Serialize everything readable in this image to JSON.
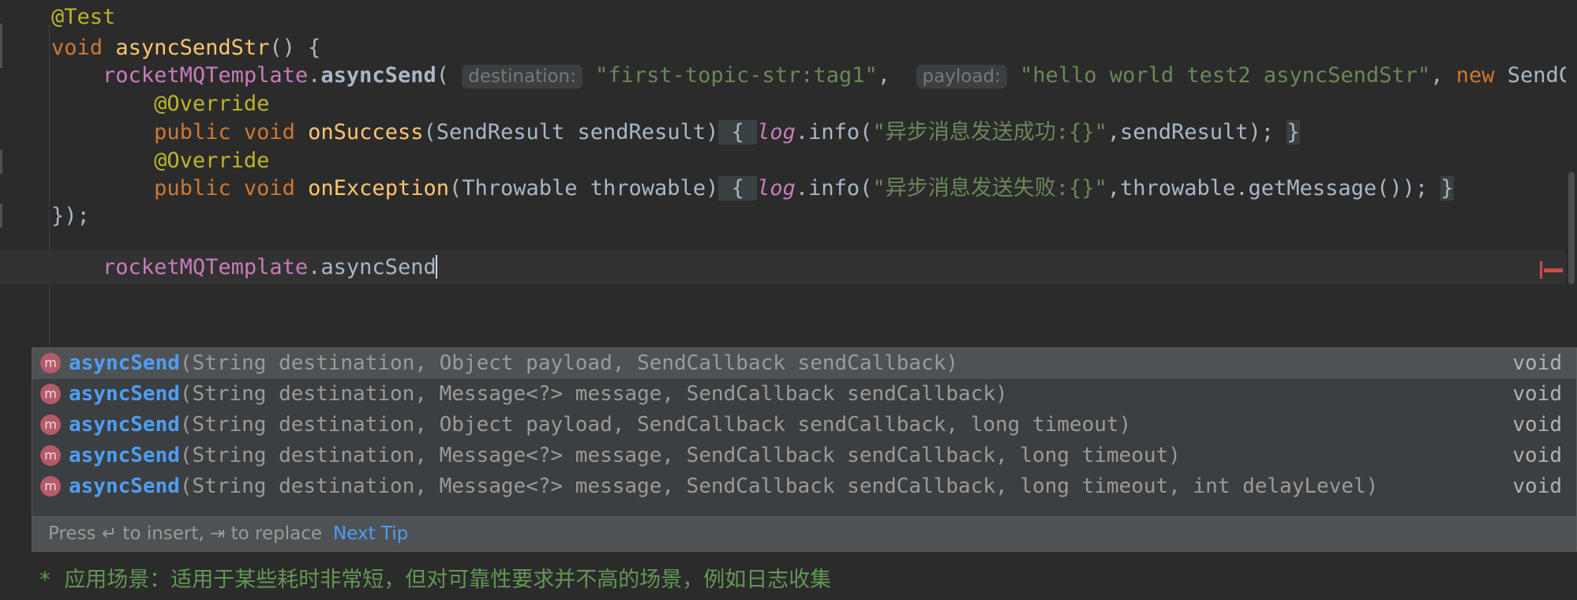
{
  "editor": {
    "language": "java",
    "theme": "darcula",
    "background": "#2b2b2b",
    "lines": [
      {
        "indent": "    ",
        "annotation": "@Test"
      },
      {
        "indent": "    ",
        "kw": "void",
        "method": "asyncSendStr",
        "tail": "() {"
      },
      {
        "indent": "        ",
        "field": "rocketMQTemplate",
        "dot": ".",
        "method": "asyncSend",
        "open": "(",
        "hint1": "destination:",
        "str1": "\"first-topic-str:tag1\"",
        "comma1": ",",
        "hint2": "payload:",
        "str2": "\"hello world test2 asyncSendStr\"",
        "comma2": ",",
        "kw_new": "new",
        "cls": "SendCall"
      },
      {
        "indent": "            ",
        "annotation": "@Override"
      },
      {
        "indent": "            ",
        "mods": "public void ",
        "method": "onSuccess",
        "params": "(SendResult sendResult)",
        "brace_open": " { ",
        "logger": "log",
        "call": ".info(",
        "str": "\"异步消息发送成功:{}\"",
        "args": ",sendResult); ",
        "brace_close": "}"
      },
      {
        "indent": "            ",
        "annotation": "@Override"
      },
      {
        "indent": "            ",
        "mods": "public void ",
        "method": "onException",
        "params": "(Throwable throwable)",
        "brace_open": " { ",
        "logger": "log",
        "call": ".info(",
        "str": "\"异步消息发送失败:{}\"",
        "args": ",throwable.getMessage()); ",
        "brace_close": "}"
      },
      {
        "indent": "    ",
        "plain": "});"
      },
      {
        "indent": "        ",
        "field": "rocketMQTemplate",
        "dot": ".",
        "plain2": "asyncSend",
        "caret": true
      }
    ]
  },
  "completion_popup": {
    "visible": true,
    "icon_label": "m",
    "selected_index": 0,
    "items": [
      {
        "name": "asyncSend",
        "signature": "(String destination, Object payload, SendCallback sendCallback)",
        "return_type": "void"
      },
      {
        "name": "asyncSend",
        "signature": "(String destination, Message<?> message, SendCallback sendCallback)",
        "return_type": "void"
      },
      {
        "name": "asyncSend",
        "signature": "(String destination, Object payload, SendCallback sendCallback, long timeout)",
        "return_type": "void"
      },
      {
        "name": "asyncSend",
        "signature": "(String destination, Message<?> message, SendCallback sendCallback, long timeout)",
        "return_type": "void"
      },
      {
        "name": "asyncSend",
        "signature": "(String destination, Message<?> message, SendCallback sendCallback, long timeout, int delayLevel)",
        "return_type": "void"
      }
    ]
  },
  "hint_bar": {
    "text": "Press ↵ to insert, ⇥ to replace",
    "link_label": "Next Tip"
  },
  "bottom_comment": {
    "marker": "*",
    "text": "应用场景：适用于某些耗时非常短，但对可靠性要求并不高的场景，例如日志收集"
  },
  "colors": {
    "background": "#2b2b2b",
    "popup_bg": "#3c3f41",
    "popup_selected": "#4e5254",
    "accent_blue": "#4d9ef6",
    "string_green": "#6a8759",
    "keyword_orange": "#cc7832",
    "method_yellow": "#ffc66d",
    "annotation_olive": "#bbb529",
    "field_purple": "#c77dbb",
    "comment_green": "#629755",
    "error_red": "#cc4b4b"
  }
}
